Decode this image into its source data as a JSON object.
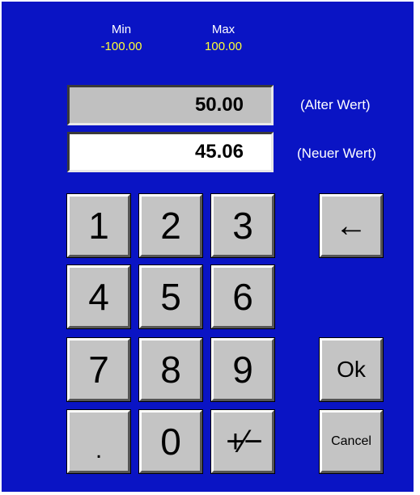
{
  "range": {
    "min_label": "Min",
    "min_value": "-100.00",
    "max_label": "Max",
    "max_value": "100.00"
  },
  "fields": {
    "old_value": "50.00",
    "old_label": "(Alter Wert)",
    "new_value": "45.06",
    "new_label": "(Neuer Wert)"
  },
  "keypad": {
    "k1": "1",
    "k2": "2",
    "k3": "3",
    "k4": "4",
    "k5": "5",
    "k6": "6",
    "k7": "7",
    "k8": "8",
    "k9": "9",
    "dot": ".",
    "k0": "0",
    "plusminus": "+⁄−",
    "backspace": "←",
    "ok": "Ok",
    "cancel": "Cancel"
  },
  "colors": {
    "panel_background": "#0a14c4",
    "range_value_color": "#ffff33",
    "key_face": "#c4c4c4"
  }
}
